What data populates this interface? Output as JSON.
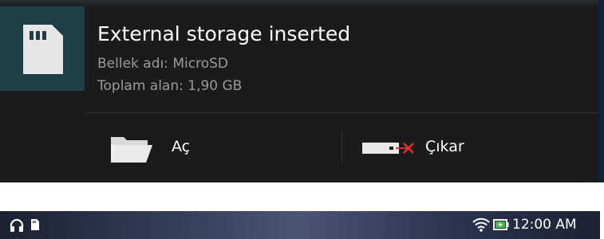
{
  "notification": {
    "title": "External storage inserted",
    "line1": "Bellek adı: MicroSD",
    "line2": "Toplam alan: 1,90 GB",
    "actions": [
      {
        "label": "Aç",
        "icon": "folder-open-icon"
      },
      {
        "label": "Çıkar",
        "icon": "eject-storage-icon"
      }
    ],
    "icon": "sd-card-icon"
  },
  "status_bar": {
    "time": "12:00 AM",
    "left_icons": [
      "headphones-icon",
      "sd-card-icon"
    ],
    "right_icons": [
      "wifi-icon",
      "battery-charging-icon"
    ]
  },
  "colors": {
    "notification_bg": "#1b1b1b",
    "icon_tile_bg": "#1f3e46",
    "text_primary": "#ffffff",
    "text_secondary": "#9a9a9a",
    "eject_x": "#e03030"
  }
}
